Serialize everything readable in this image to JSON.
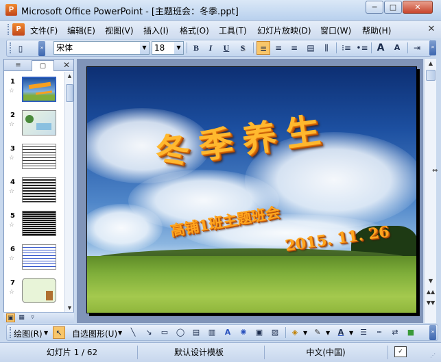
{
  "window": {
    "title": "Microsoft Office PowerPoint - [主题班会：冬季.ppt]",
    "app_icon": "P",
    "minimize_glyph": "─",
    "maximize_glyph": "□",
    "close_glyph": "✕"
  },
  "menubar": {
    "items": [
      "文件(F)",
      "编辑(E)",
      "视图(V)",
      "插入(I)",
      "格式(O)",
      "工具(T)",
      "幻灯片放映(D)",
      "窗口(W)",
      "帮助(H)"
    ],
    "close_glyph": "✕"
  },
  "format_toolbar": {
    "font": "宋体",
    "size": "18",
    "bold": "B",
    "italic": "I",
    "underline": "U",
    "shadow": "S",
    "align_left": "≡",
    "align_center": "≡",
    "align_right": "≡",
    "distribute": "▤",
    "col_spacing": "⫼",
    "numbered": "⁝≡",
    "bulleted": "•≡",
    "grow_font": "A",
    "shrink_font": "A",
    "indent": "⇥",
    "overflow": "»"
  },
  "left_panel": {
    "tab_outline": "≡",
    "tab_slides": "▢",
    "close_glyph": "✕",
    "slides": [
      {
        "num": "1",
        "star": "☆"
      },
      {
        "num": "2",
        "star": "☆"
      },
      {
        "num": "3",
        "star": "☆"
      },
      {
        "num": "4",
        "star": "☆"
      },
      {
        "num": "5",
        "star": "☆"
      },
      {
        "num": "6",
        "star": "☆"
      },
      {
        "num": "7",
        "star": "☆"
      }
    ]
  },
  "slide": {
    "title": "冬季养生",
    "subtitle": "高铺1班主题班会",
    "date": "2015. 11. 26"
  },
  "drawing_toolbar": {
    "draw": "绘图(R)",
    "autoshapes": "自选图形(U)"
  },
  "statusbar": {
    "slide_info": "幻灯片 1 / 62",
    "design": "默认设计模板",
    "language": "中文(中国)"
  }
}
